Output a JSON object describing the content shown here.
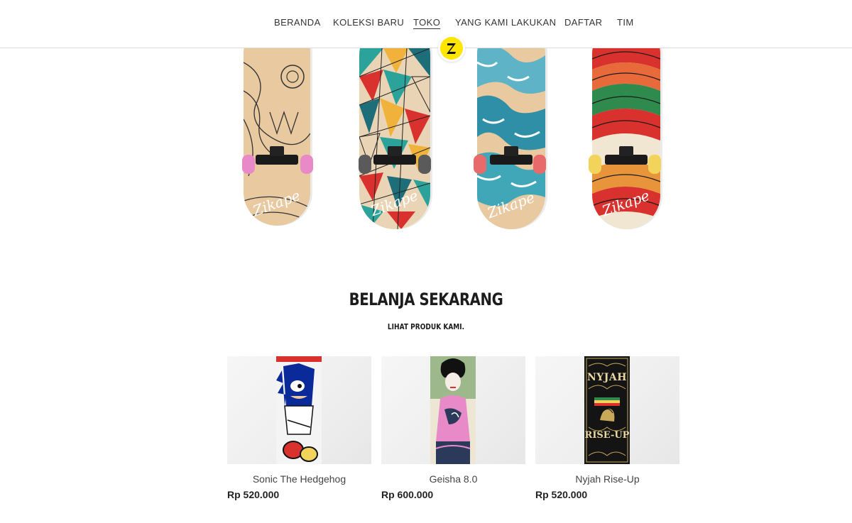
{
  "nav": {
    "items": [
      {
        "label": "BERANDA"
      },
      {
        "label": "KOLEKSI BARU"
      },
      {
        "label": "TOKO",
        "active": true
      },
      {
        "label": "YANG KAMI LAKUKAN"
      },
      {
        "label": "DAFTAR"
      },
      {
        "label": "TIM"
      }
    ]
  },
  "logo": {
    "letter": "Z",
    "color": "#FFE500"
  },
  "hero": {
    "brand_text": "Zikape",
    "decks": [
      {
        "style": "line-art-wood",
        "wheel_color": "#E98AC8"
      },
      {
        "style": "geometric-triangles",
        "wheel_color": "#5A5A5A"
      },
      {
        "style": "great-wave",
        "wheel_color": "#E86A6A"
      },
      {
        "style": "sunset-waves",
        "wheel_color": "#F2D45A"
      }
    ]
  },
  "shop": {
    "title": "BELANJA SEKARANG",
    "subtitle": "LIHAT PRODUK KAMI.",
    "products": [
      {
        "name": "Sonic The Hedgehog",
        "price": "Rp 520.000",
        "image": "sonic-deck"
      },
      {
        "name": "Geisha 8.0",
        "price": "Rp 600.000",
        "image": "geisha-deck"
      },
      {
        "name": "Nyjah Rise-Up",
        "price": "Rp 520.000",
        "image": "nyjah-deck",
        "deck_text_top": "NYJAH",
        "deck_text_bottom": "RISE-UP"
      }
    ]
  },
  "colors": {
    "accent": "#FFE500",
    "text": "#222222",
    "border": "#DCDCDC"
  }
}
